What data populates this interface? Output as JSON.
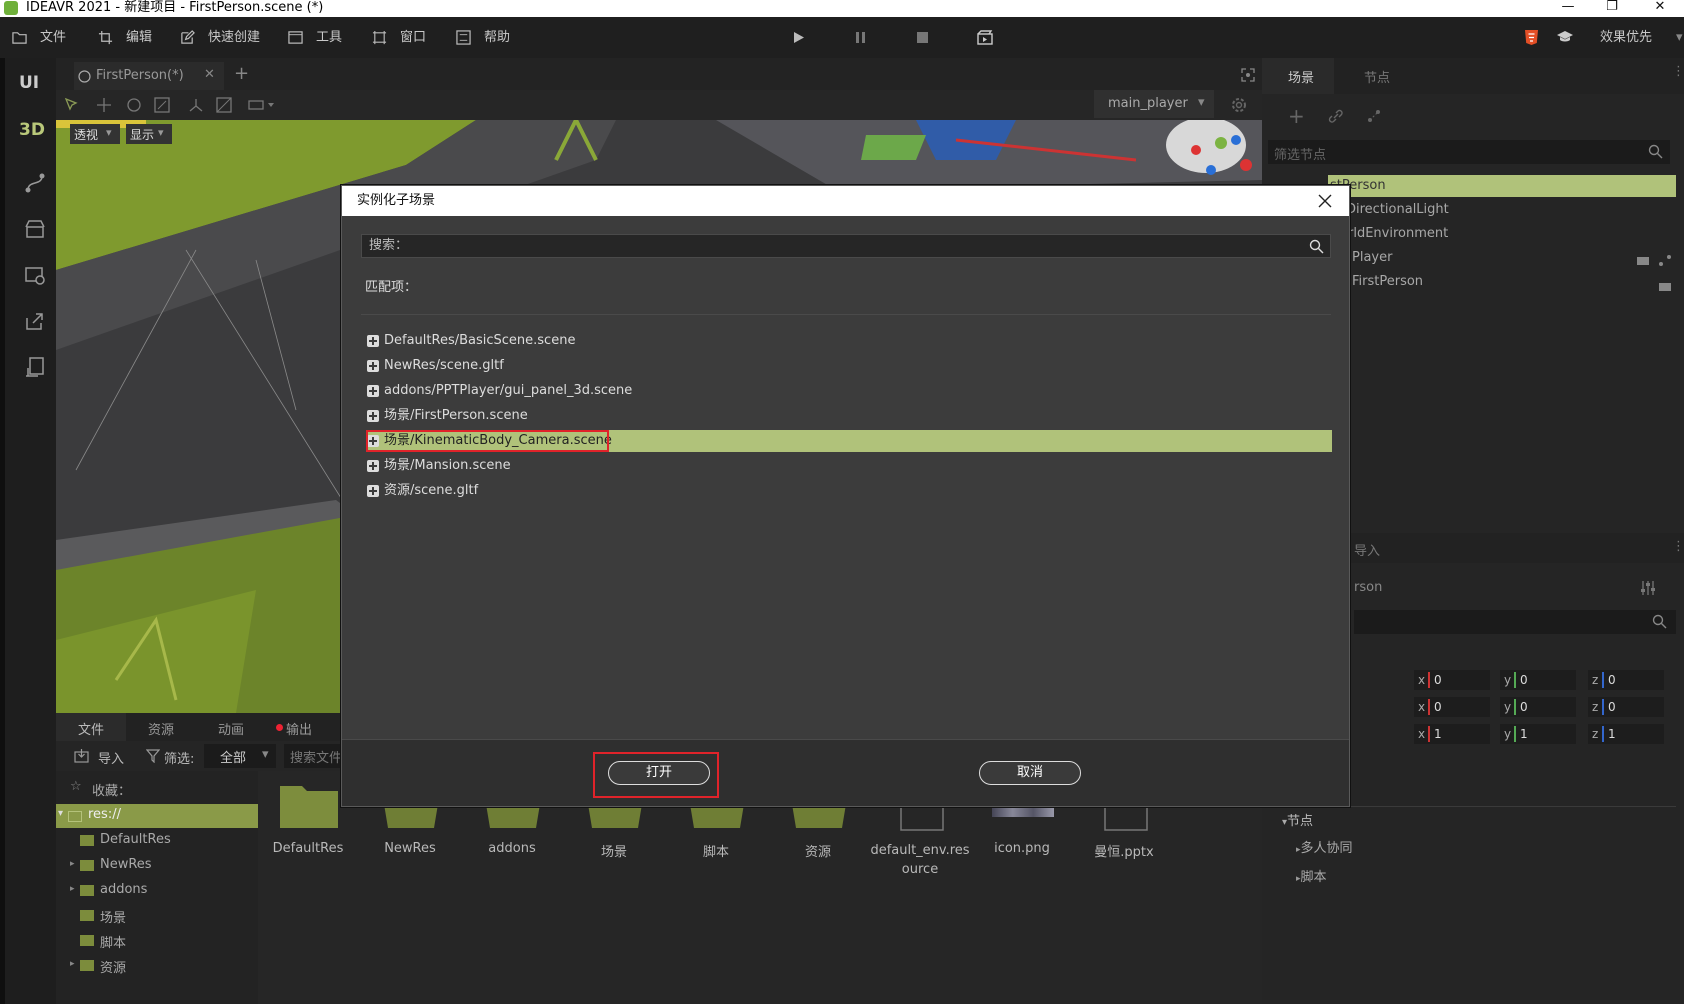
{
  "window": {
    "title": "IDEAVR 2021 - 新建项目 - FirstPerson.scene (*)",
    "minimize": "—",
    "restore": "❐",
    "close": "✕"
  },
  "menubar": {
    "items": [
      {
        "label": "文件",
        "icon": "folder-icon"
      },
      {
        "label": "编辑",
        "icon": "crop-icon"
      },
      {
        "label": "快速创建",
        "icon": "edit-icon"
      },
      {
        "label": "工具",
        "icon": "window-icon"
      },
      {
        "label": "窗口",
        "icon": "frame-icon"
      },
      {
        "label": "帮助",
        "icon": "help-icon"
      }
    ],
    "quality": "效果优先"
  },
  "leftstrip": {
    "ui": "UI",
    "three_d": "3D"
  },
  "viewport": {
    "tab": "FirstPerson(*)",
    "camera": "main_player",
    "perspective": "透视",
    "display": "显示"
  },
  "bottom": {
    "tabs": [
      "文件",
      "资源",
      "动画",
      "输出"
    ],
    "import": "导入",
    "filter": "筛选:",
    "filter_value": "全部",
    "search_placeholder": "搜索文件",
    "favorites": "收藏：",
    "tree": [
      "res://",
      "DefaultRes",
      "NewRes",
      "addons",
      "场景",
      "脚本",
      "资源"
    ],
    "files": [
      {
        "name": "DefaultRes",
        "type": "folder"
      },
      {
        "name": "NewRes",
        "type": "folder"
      },
      {
        "name": "addons",
        "type": "folder"
      },
      {
        "name": "场景",
        "type": "folder"
      },
      {
        "name": "脚本",
        "type": "folder"
      },
      {
        "name": "资源",
        "type": "folder"
      },
      {
        "name": "default_env.res\nource",
        "type": "file"
      },
      {
        "name": "icon.png",
        "type": "image"
      },
      {
        "name": "曼恒.pptx",
        "type": "file"
      }
    ]
  },
  "right": {
    "tabs": [
      "场景",
      "节点"
    ],
    "filter_placeholder": "筛选节点",
    "nodes": [
      "FirstPerson",
      "DirectionalLight",
      "WorldEnvironment",
      "Player",
      "FirstPerson"
    ],
    "nodes_visible": [
      "stPerson",
      "DirectionalLight",
      "rldEnvironment",
      "Player",
      "FirstPerson"
    ],
    "inspector_tab": "导入",
    "inspector_title": "rson",
    "transform": [
      {
        "x": "0",
        "y": "0",
        "z": "0"
      },
      {
        "x": "0",
        "y": "0",
        "z": "0"
      },
      {
        "x": "1",
        "y": "1",
        "z": "1"
      }
    ],
    "node_section": "节点",
    "sub_sections": [
      "多人协同",
      "脚本"
    ]
  },
  "dialog": {
    "title": "实例化子场景",
    "search_label": "搜索：",
    "matches_label": "匹配项：",
    "items": [
      "DefaultRes/BasicScene.scene",
      "NewRes/scene.gltf",
      "addons/PPTPlayer/gui_panel_3d.scene",
      "场景/FirstPerson.scene",
      "场景/KinematicBody_Camera.scene",
      "场景/Mansion.scene",
      "资源/scene.gltf"
    ],
    "selected_index": 4,
    "open": "打开",
    "cancel": "取消"
  },
  "colors": {
    "accent": "#b0c27a",
    "highlight": "#e0232a",
    "grass": "#7f9a2e"
  }
}
